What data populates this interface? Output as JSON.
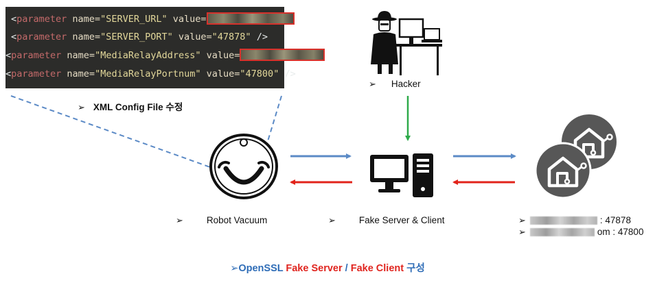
{
  "xml_config": {
    "lines": [
      {
        "open": "<",
        "keyword": "parameter",
        "name_attr": " name=",
        "name_value": "\"SERVER_URL\"",
        "value_attr": " value=",
        "value": "",
        "close": ""
      },
      {
        "open": "<",
        "keyword": "parameter",
        "name_attr": " name=",
        "name_value": "\"SERVER_PORT\"",
        "value_attr": " value=",
        "value": "\"47878\"",
        "close": " />"
      },
      {
        "open": "<",
        "keyword": "parameter",
        "name_attr": " name=",
        "name_value": "\"MediaRelayAddress\"",
        "value_attr": " value=",
        "value": "",
        "close": ""
      },
      {
        "open": "<",
        "keyword": "parameter",
        "name_attr": " name=",
        "name_value": "\"MediaRelayPortnum\"",
        "value_attr": " value=",
        "value": "\"47800\"",
        "close": " />"
      }
    ],
    "caption_bullet": "➢",
    "caption": "XML Config File 수정"
  },
  "nodes": {
    "hacker": {
      "bullet": "➢",
      "label": "Hacker"
    },
    "robot": {
      "bullet": "➢",
      "label": "Robot Vacuum"
    },
    "fake": {
      "bullet": "➢",
      "label": "Fake Server & Client"
    },
    "server": {
      "bullet": "➢",
      "line1_suffix": ": 47878",
      "line2_suffix": "om : 47800"
    }
  },
  "footer": {
    "bullet": "➢",
    "part1": "OpenSSL ",
    "part2": "Fake Server",
    "part3": " / ",
    "part4": "Fake Client",
    "part5": " 구성"
  },
  "colors": {
    "blue_arrow": "#5b8ac6",
    "red_arrow": "#e2231a",
    "green_arrow": "#2eaa4a",
    "dashed_line": "#5b8ac6",
    "cloud_icon_bg": "#575757"
  },
  "icons": [
    "hacker-icon",
    "robot-vacuum-icon",
    "desktop-computer-icon",
    "smart-home-icon"
  ]
}
